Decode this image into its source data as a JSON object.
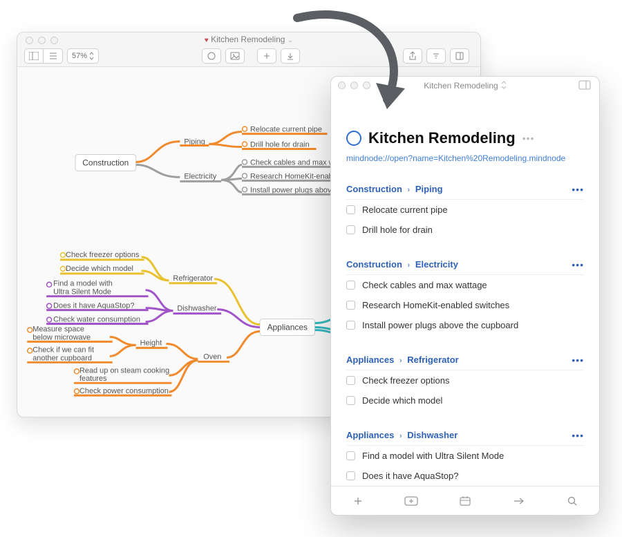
{
  "mindnode": {
    "title": "Kitchen Remodeling",
    "zoom": "57%",
    "nodes": {
      "construction": "Construction",
      "piping": "Piping",
      "electricity": "Electricity",
      "appliances": "Appliances",
      "refrigerator": "Refrigerator",
      "dishwasher": "Dishwasher",
      "oven": "Oven",
      "height": "Height"
    },
    "leaves": {
      "relocate_pipe": "Relocate current pipe",
      "drill_hole": "Drill hole for drain",
      "check_cables": "Check cables and max wattage",
      "research_homekit": "Research HomeKit-enabled swit",
      "install_plugs": "Install power plugs above the cu",
      "check_freezer": "Check freezer options",
      "decide_model": "Decide which model",
      "ultra_silent": "Find a model with\nUltra Silent Mode",
      "aquastop": "Does it have AquaStop?",
      "water_cons": "Check water consumption",
      "measure_space": "Measure space\nbelow microwave",
      "fit_cupboard": "Check if we can fit\nanother cupboard",
      "steam_cooking": "Read up on steam cooking\nfeatures",
      "power_cons": "Check power consumption"
    }
  },
  "things": {
    "window_title": "Kitchen Remodeling",
    "project_title": "Kitchen Remodeling",
    "link": "mindnode://open?name=Kitchen%20Remodeling.mindnode",
    "headings": [
      {
        "path_a": "Construction",
        "path_b": "Piping"
      },
      {
        "path_a": "Construction",
        "path_b": "Electricity"
      },
      {
        "path_a": "Appliances",
        "path_b": "Refrigerator"
      },
      {
        "path_a": "Appliances",
        "path_b": "Dishwasher"
      }
    ],
    "tasks": {
      "h0": [
        "Relocate current pipe",
        "Drill hole for drain"
      ],
      "h1": [
        "Check cables and max wattage",
        "Research HomeKit-enabled switches",
        "Install power plugs above the cupboard"
      ],
      "h2": [
        "Check freezer options",
        "Decide which model"
      ],
      "h3": [
        "Find a model with Ultra Silent Mode",
        "Does it have AquaStop?"
      ]
    }
  },
  "colors": {
    "orange": "#f08a2c",
    "yellow": "#e8c22e",
    "purple": "#a154c8",
    "teal": "#35b7c0",
    "gray": "#9e9e9e"
  }
}
